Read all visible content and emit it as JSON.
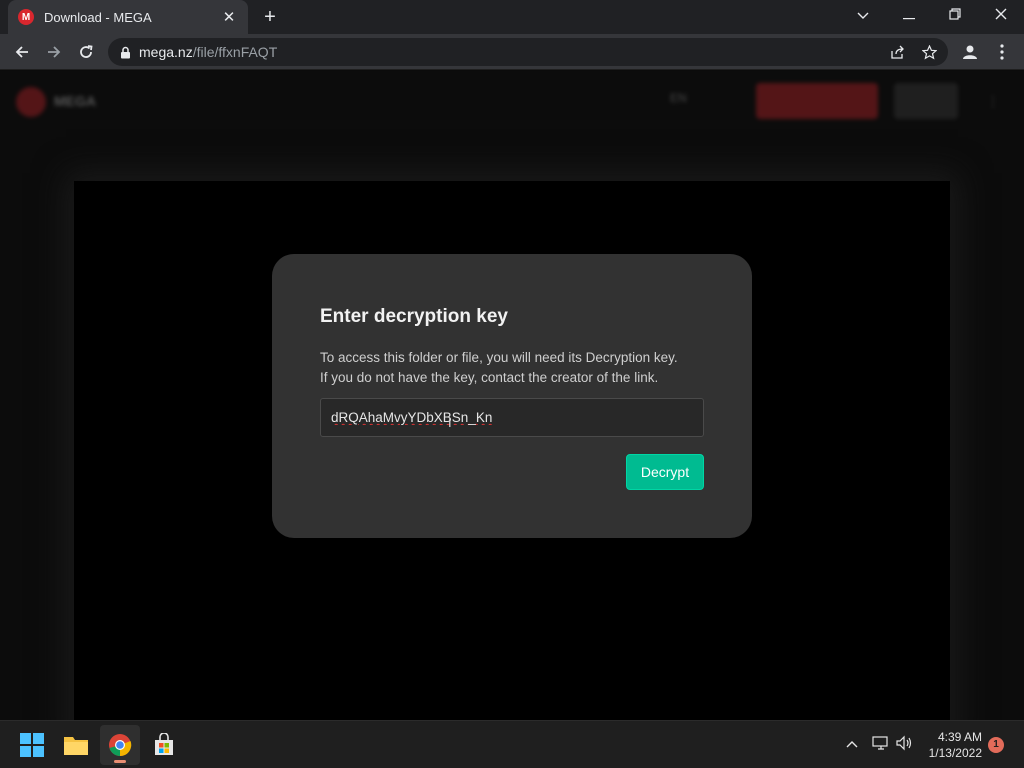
{
  "browser": {
    "tab": {
      "title": "Download - MEGA",
      "favicon_letter": "M",
      "close_label": "✕"
    },
    "new_tab_label": "+",
    "window": {
      "dropdown": "⌄",
      "minimize": "—",
      "restore": "❐",
      "close": "✕"
    },
    "address": {
      "host": "mega.nz",
      "path": "/file/ffxnFAQT"
    }
  },
  "mega_header": {
    "brand": "MEGA",
    "language": "EN"
  },
  "dialog": {
    "title": "Enter decryption key",
    "text_line1": "To access this folder or file, you will need its Decryption key.",
    "text_line2": "If you do not have the key, contact the creator of the link.",
    "key_value": "dRQAhaMvyYDbXBSn_Kn",
    "decrypt_label": "Decrypt"
  },
  "taskbar": {
    "apps": [
      "start-icon",
      "file-explorer-icon",
      "chrome-icon",
      "microsoft-store-icon"
    ],
    "time": "4:39 AM",
    "date": "1/13/2022",
    "notification_count": "1"
  },
  "colors": {
    "accent": "#00bb91",
    "brand": "#d9272e",
    "dialog_bg": "#323232"
  }
}
